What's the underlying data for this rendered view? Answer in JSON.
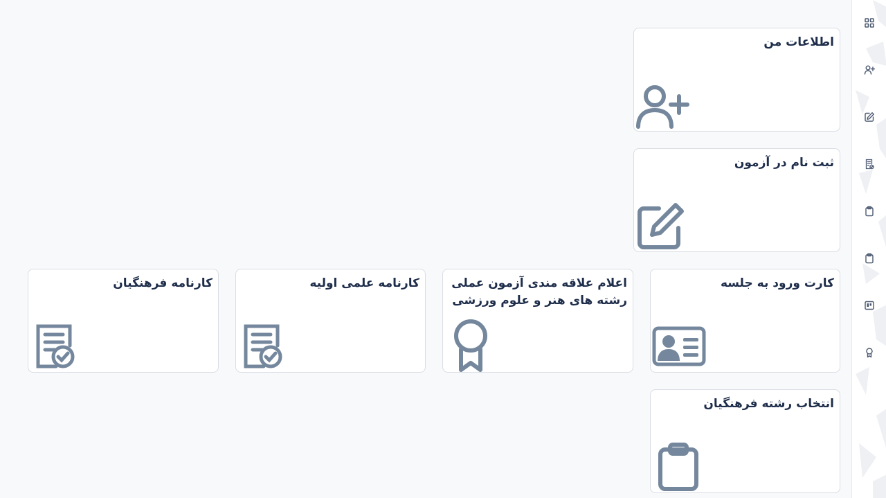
{
  "colors": {
    "background": "#f8f9fb",
    "card": "#ffffff",
    "card_border": "#d9dde3",
    "title": "#1e2d4a",
    "icon": "#74879c",
    "sidebar_icon": "#4a5870"
  },
  "sidebar": {
    "items": [
      {
        "icon": "dashboard-icon"
      },
      {
        "icon": "user-plus-icon"
      },
      {
        "icon": "edit-icon"
      },
      {
        "icon": "report-card-icon"
      },
      {
        "icon": "clipboard-icon"
      },
      {
        "icon": "clipboard-icon"
      },
      {
        "icon": "id-card-icon"
      },
      {
        "icon": "award-icon"
      }
    ]
  },
  "cards": {
    "my_info": {
      "title": "اطلاعات من",
      "icon": "user-plus-icon"
    },
    "exam_registration": {
      "title": "ثبت نام در آزمون",
      "icon": "edit-icon"
    },
    "entrance_card": {
      "title": "کارت ورود به جلسه",
      "icon": "id-card-icon"
    },
    "practical_exam_interest": {
      "title": "اعلام علاقه مندی آزمون عملی رشته های هنر و علوم ورزشی",
      "icon": "award-icon"
    },
    "initial_scientific_report": {
      "title": "کارنامه علمی اولیه",
      "icon": "report-card-icon"
    },
    "farhangian_report": {
      "title": "کارنامه فرهنگیان",
      "icon": "report-card-icon"
    },
    "farhangian_major_selection": {
      "title": "انتخاب رشته فرهنگیان",
      "icon": "clipboard-icon"
    }
  }
}
